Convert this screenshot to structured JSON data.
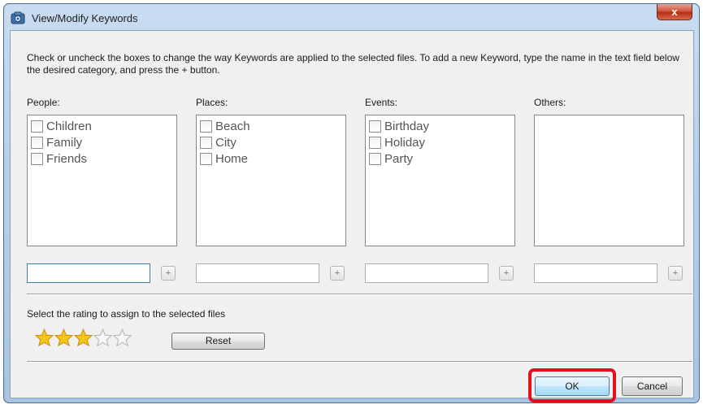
{
  "window": {
    "title": "View/Modify Keywords",
    "close_label": "x"
  },
  "instructions": "Check or uncheck the boxes to change the way Keywords are applied to the selected files. To add a new Keyword, type the name in the text field below the desired category, and press the + button.",
  "categories": [
    {
      "label": "People:",
      "keywords": [
        "Children",
        "Family",
        "Friends"
      ],
      "input_value": "",
      "add_label": "+"
    },
    {
      "label": "Places:",
      "keywords": [
        "Beach",
        "City",
        "Home"
      ],
      "input_value": "",
      "add_label": "+"
    },
    {
      "label": "Events:",
      "keywords": [
        "Birthday",
        "Holiday",
        "Party"
      ],
      "input_value": "",
      "add_label": "+"
    },
    {
      "label": "Others:",
      "keywords": [],
      "input_value": "",
      "add_label": "+"
    }
  ],
  "rating": {
    "label": "Select the rating to assign to the selected files",
    "value": 3,
    "max": 5,
    "reset_label": "Reset"
  },
  "buttons": {
    "ok": "OK",
    "cancel": "Cancel"
  },
  "colors": {
    "highlight": "#e1101b",
    "star_filled": "#f5c518",
    "title_bar": "#b7cfe9"
  }
}
